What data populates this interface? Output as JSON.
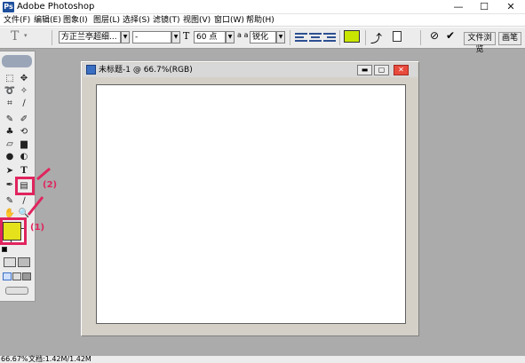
{
  "app": {
    "title": "Adobe Photoshop",
    "icon_letter": "Ps"
  },
  "window_controls": {
    "minimize": "—",
    "maximize": "☐",
    "close": "✕"
  },
  "menu": {
    "items": [
      "文件(F)",
      "编辑(E)",
      "图象(I)",
      "图层(L)",
      "选择(S)",
      "滤镜(T)",
      "视图(V)",
      "窗口(W)",
      "帮助(H)"
    ]
  },
  "options": {
    "tool_icon": "T",
    "font_family": "方正兰亭超细...",
    "font_style": "-",
    "size_icon": "T",
    "font_size": "60 点",
    "aa_icon": "a a",
    "antialias": "锐化",
    "text_color": "#c8e600",
    "file_browser_label": "文件浏览",
    "brushes_label": "画笔"
  },
  "document": {
    "title": "未标题-1 @ 66.7%(RGB)"
  },
  "foreground_color": "#e5e21c",
  "annotations": {
    "label_1": "(1)",
    "label_2": "(2)"
  },
  "status": {
    "zoom": "66.67%",
    "doc_info": "文档:1.42M/1.42M"
  }
}
